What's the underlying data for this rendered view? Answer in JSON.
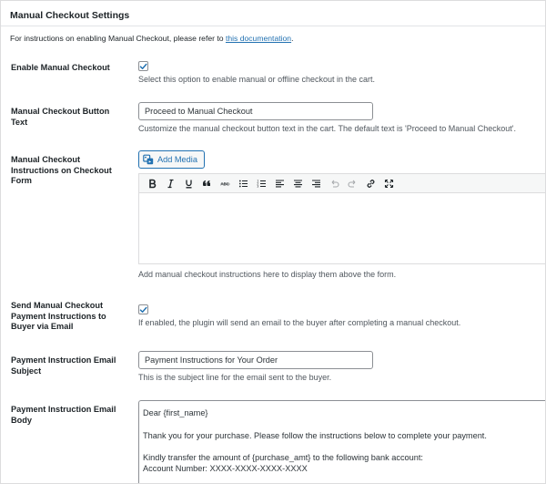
{
  "section": {
    "title": "Manual Checkout Settings",
    "intro_text": "For instructions on enabling Manual Checkout, please refer to ",
    "intro_link": "this documentation",
    "intro_end": "."
  },
  "enable_checkout": {
    "label": "Enable Manual Checkout",
    "checked": true,
    "description": "Select this option to enable manual or offline checkout in the cart."
  },
  "button_text": {
    "label": "Manual Checkout Button Text",
    "value": "Proceed to Manual Checkout",
    "description": "Customize the manual checkout button text in the cart. The default text is 'Proceed to Manual Checkout'."
  },
  "instructions": {
    "label": "Manual Checkout Instructions on Checkout Form",
    "add_media_label": "Add Media",
    "toolbar_icons": [
      "bold-icon",
      "italic-icon",
      "underline-icon",
      "blockquote-icon",
      "strikethrough-icon",
      "bullet-list-icon",
      "numbered-list-icon",
      "align-left-icon",
      "align-center-icon",
      "align-right-icon",
      "undo-icon",
      "redo-icon",
      "link-icon",
      "fullscreen-icon"
    ],
    "description": "Add manual checkout instructions here to display them above the form."
  },
  "send_email": {
    "label": "Send Manual Checkout Payment Instructions to Buyer via Email",
    "checked": true,
    "description": "If enabled, the plugin will send an email to the buyer after completing a manual checkout."
  },
  "email_subject": {
    "label": "Payment Instruction Email Subject",
    "value": "Payment Instructions for Your Order",
    "description": "This is the subject line for the email sent to the buyer."
  },
  "email_body": {
    "label": "Payment Instruction Email Body",
    "lines": [
      "Dear {first_name}",
      "",
      "Thank you for your purchase. Please follow the instructions below to complete your payment.",
      "",
      "Kindly transfer the amount of {purchase_amt} to the following bank account:",
      "Account Number: XXXX-XXXX-XXXX-XXXX"
    ]
  },
  "colors": {
    "link": "#2271b1",
    "border": "#8c8f94",
    "description_text": "#50575e"
  }
}
